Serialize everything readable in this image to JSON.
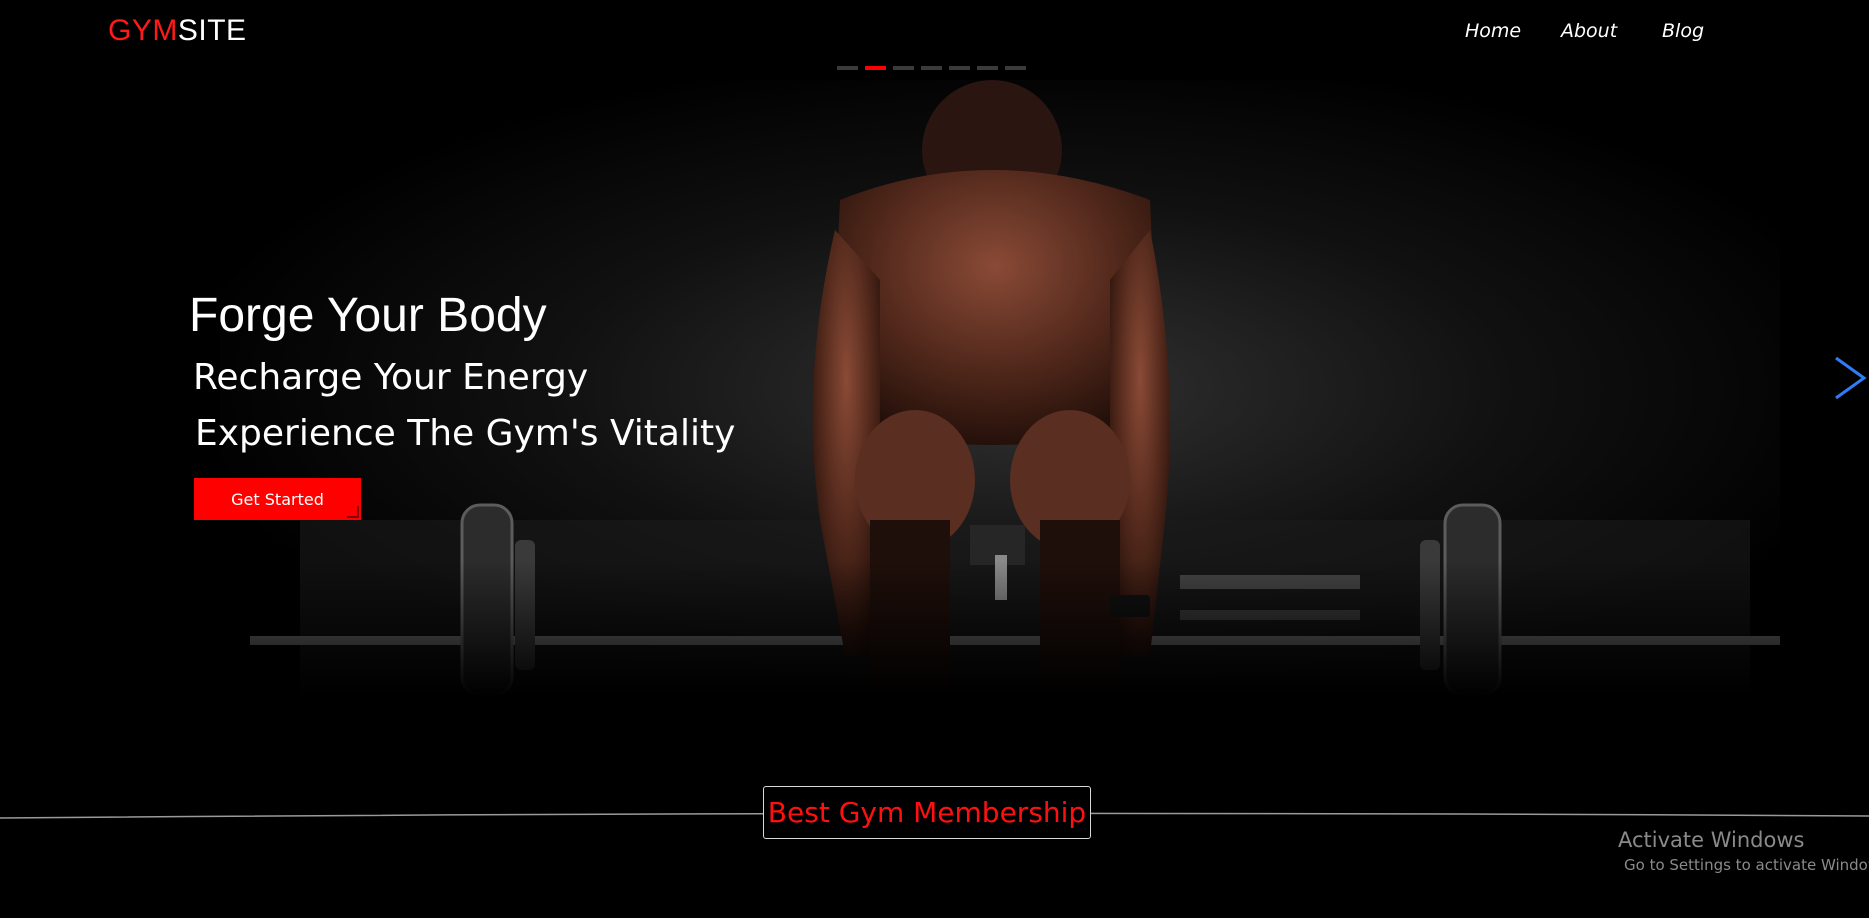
{
  "header": {
    "logo_accent": "GYM",
    "logo_rest": "SITE",
    "nav": [
      "Home",
      "About",
      "Blog"
    ]
  },
  "carousel": {
    "slide_count": 7,
    "active_slide": 2
  },
  "hero": {
    "title": "Forge Your Body",
    "line1": "Recharge Your Energy",
    "line2": "Experience The Gym's Vitality",
    "cta_label": "Get Started",
    "next_icon": "chevron-right-icon"
  },
  "section": {
    "badge": "Best Gym Membership"
  },
  "watermark": {
    "title": "Activate Windows",
    "subtitle": "Go to Settings to activate Windows."
  },
  "colors": {
    "accent": "#ff0000",
    "background": "#000000",
    "arrow": "#2f7df6"
  }
}
